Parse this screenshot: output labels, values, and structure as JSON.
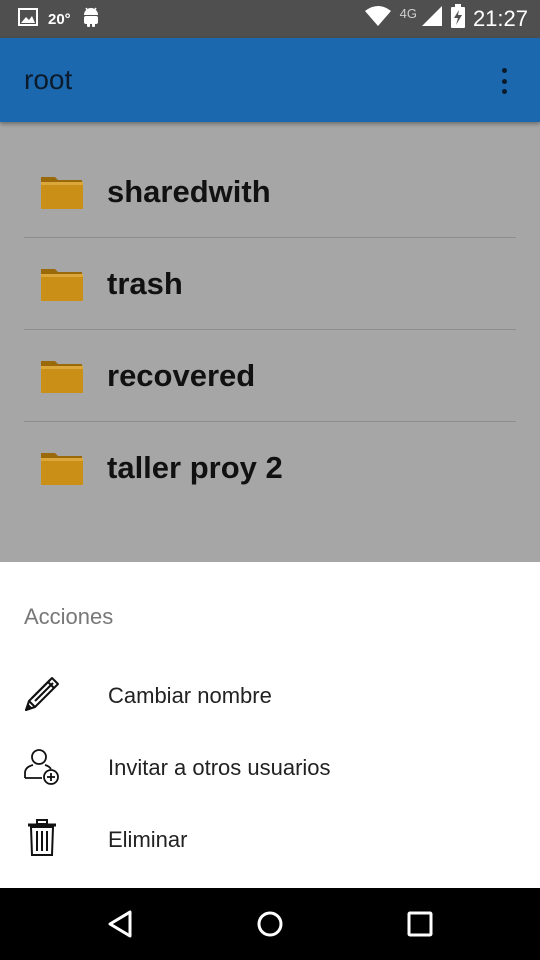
{
  "status_bar": {
    "temperature": "20°",
    "network_type": "4G",
    "time": "21:27",
    "icons": [
      "image-icon",
      "android-icon",
      "wifi-icon",
      "signal-icon",
      "battery-charging-icon"
    ]
  },
  "app_bar": {
    "title": "root",
    "menu_icon": "overflow-menu-icon"
  },
  "folders": [
    {
      "name": "sharedwith",
      "icon": "folder-icon"
    },
    {
      "name": "trash",
      "icon": "folder-icon"
    },
    {
      "name": "recovered",
      "icon": "folder-icon"
    },
    {
      "name": "taller proy 2",
      "icon": "folder-icon"
    }
  ],
  "bottom_sheet": {
    "title": "Acciones",
    "actions": [
      {
        "label": "Cambiar nombre",
        "icon": "pencil-icon"
      },
      {
        "label": "Invitar a otros usuarios",
        "icon": "add-user-icon"
      },
      {
        "label": "Eliminar",
        "icon": "trash-icon"
      }
    ]
  },
  "nav_bar": {
    "buttons": [
      "back-icon",
      "home-icon",
      "recents-icon"
    ]
  },
  "colors": {
    "app_bar": "#1b68ae",
    "status_bar": "#4f4f4f",
    "scrim_background": "#a6a6a6",
    "folder": "#c98f16",
    "sheet": "#ffffff",
    "nav_bar": "#000000"
  }
}
